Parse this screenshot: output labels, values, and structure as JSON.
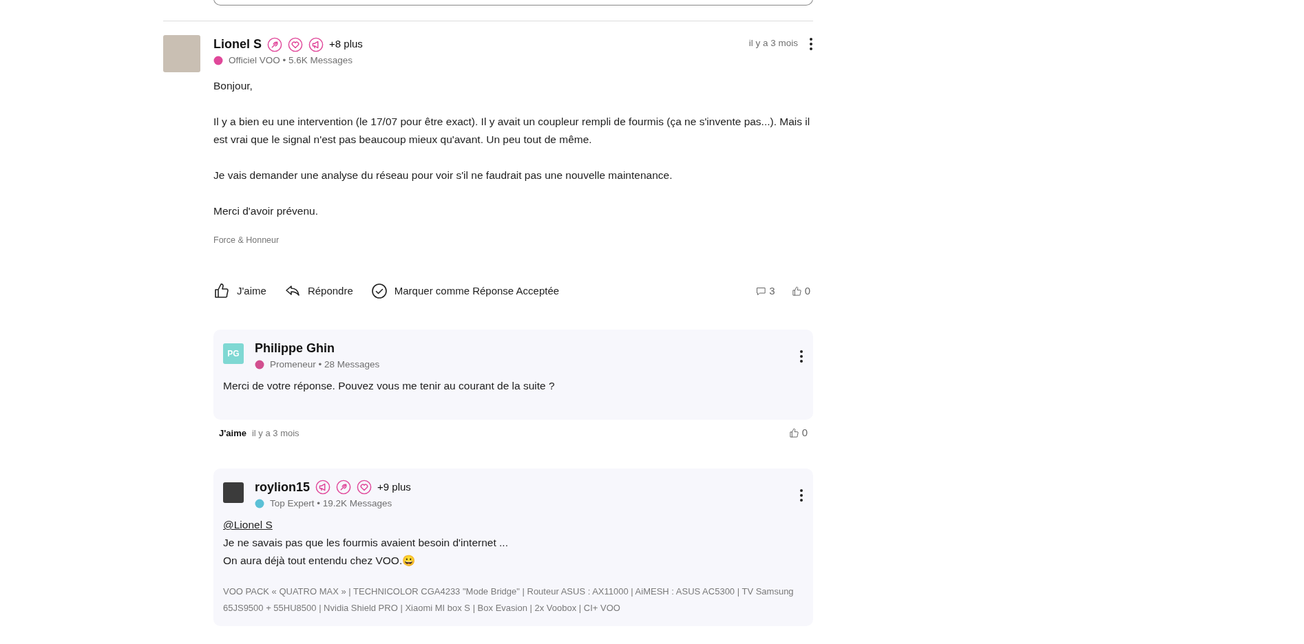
{
  "post": {
    "author": "Lionel S",
    "avatar": {
      "kind": "photo"
    },
    "badges": [
      {
        "kind": "rocket"
      },
      {
        "kind": "heart"
      },
      {
        "kind": "megaphone"
      }
    ],
    "more_badges": "+8 plus",
    "color": "#e0489a",
    "meta": "Officiel VOO • 5.6K Messages",
    "time": "il y a 3 mois",
    "paragraphs": [
      "Bonjour,",
      "Il y a bien eu une intervention (le 17/07 pour être exact). Il y avait un coupleur rempli de fourmis (ça ne s'invente pas...). Mais il est vrai que le signal n'est pas beaucoup mieux qu'avant. Un peu tout de même.",
      "Je vais demander une analyse du réseau pour voir s'il ne faudrait pas une nouvelle maintenance.",
      "Merci d'avoir prévenu."
    ],
    "signature": "Force & Honneur",
    "actions": [
      {
        "kind": "like",
        "label": "J'aime"
      },
      {
        "kind": "reply",
        "label": "Répondre"
      },
      {
        "kind": "accept",
        "label": "Marquer comme Réponse Acceptée"
      }
    ],
    "stats": [
      {
        "kind": "comments",
        "value": "3"
      },
      {
        "kind": "likes",
        "value": "0"
      }
    ]
  },
  "replies": [
    {
      "author": "Philippe Ghin",
      "avatar": {
        "kind": "initials",
        "text": "PG"
      },
      "color": "#d24f8f",
      "meta": "Promeneur • 28 Messages",
      "lines": [
        {
          "kind": "text",
          "text": "Merci de votre réponse. Pouvez vous me tenir au courant de la suite ?"
        }
      ],
      "footer": {
        "like": "J'aime",
        "time": "il y a 3 mois",
        "likes": "0"
      }
    },
    {
      "author": "roylion15",
      "avatar": {
        "kind": "photo"
      },
      "badges": [
        {
          "kind": "megaphone"
        },
        {
          "kind": "rocket"
        },
        {
          "kind": "heart"
        }
      ],
      "more_badges": "+9 plus",
      "color": "#5bc0d6",
      "meta": "Top Expert • 19.2K Messages",
      "lines": [
        {
          "kind": "mention",
          "text": "@Lionel S"
        },
        {
          "kind": "text",
          "text": "Je ne savais pas que les fourmis avaient besoin d'internet ..."
        },
        {
          "kind": "text",
          "text": "On aura déjà tout entendu chez VOO.😀"
        }
      ],
      "signature": "VOO PACK « QUATRO MAX » | TECHNICOLOR CGA4233 \"Mode Bridge\" | Routeur ASUS : AX11000 | AiMESH : ASUS AC5300 | TV Samsung 65JS9500 + 55HU8500 | Nvidia Shield PRO | Xiaomi MI box S | Box Evasion | 2x Voobox | CI+ VOO"
    }
  ]
}
